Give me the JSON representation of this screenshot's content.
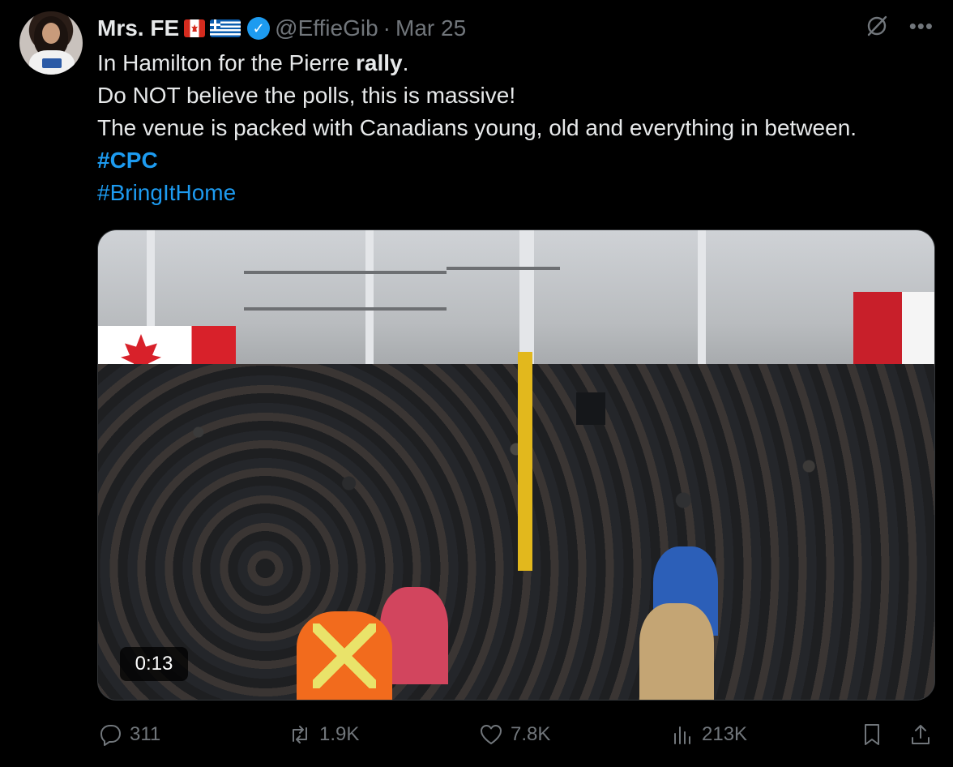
{
  "author": {
    "display_name": "Mrs. FE",
    "flags": [
      "canada-flag-icon",
      "greece-flag-icon"
    ],
    "verified": true,
    "handle": "@EffieGib",
    "separator": "·",
    "date": "Mar 25"
  },
  "tweet": {
    "line1_prefix": "In Hamilton for the Pierre ",
    "line1_bold": "rally",
    "line1_suffix": ".",
    "line2": "Do NOT believe the polls, this is massive!",
    "line3": "The venue is packed with Canadians young, old and everything in between.",
    "hashtag1": "#CPC",
    "hashtag2": "#BringItHome"
  },
  "media": {
    "type": "video",
    "duration": "0:13"
  },
  "actions": {
    "replies": "311",
    "reposts": "1.9K",
    "likes": "7.8K",
    "views": "213K"
  },
  "colors": {
    "background": "#000000",
    "text": "#e7e9ea",
    "muted": "#71767b",
    "accent": "#1d9bf0"
  }
}
